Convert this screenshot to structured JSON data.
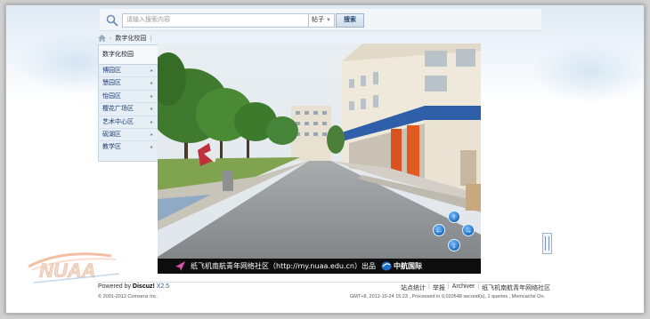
{
  "search": {
    "placeholder": "请输入搜索内容",
    "type_selected": "帖子",
    "button_label": "搜索"
  },
  "breadcrumb": {
    "current": "数字化校园"
  },
  "sidebar": {
    "title": "数字化校园",
    "items": [
      {
        "label": "博园区"
      },
      {
        "label": "慧园区"
      },
      {
        "label": "怡园区"
      },
      {
        "label": "樱花广场区"
      },
      {
        "label": "艺术中心区"
      },
      {
        "label": "砚湖区"
      },
      {
        "label": "教学区"
      }
    ]
  },
  "panorama": {
    "banner_text": "纸飞机南航青年网络社区（http://my.nuaa.edu.cn）出品",
    "banner_brand": "中航国际",
    "nav_icons": [
      "arrow-up-icon",
      "arrow-left-icon",
      "arrow-right-icon",
      "arrow-down-icon"
    ]
  },
  "logo": {
    "text": "NUAA"
  },
  "footer": {
    "powered_prefix": "Powered by ",
    "powered_brand": "Discuz!",
    "powered_version": " X2.5",
    "copyright": "© 2001-2012 Comsenz Inc.",
    "links": [
      "站点统计",
      "举报",
      "Archiver",
      "纸飞机南航青年网络社区"
    ],
    "meta": "GMT+8, 2012-10-24 15:23 , Processed in 0.020548 second(s), 1 queries , Memcache On."
  },
  "colors": {
    "accent": "#1c3d6e",
    "banner_bg": "#0d0d0d",
    "sidebar_bg": "#e6eef6"
  }
}
